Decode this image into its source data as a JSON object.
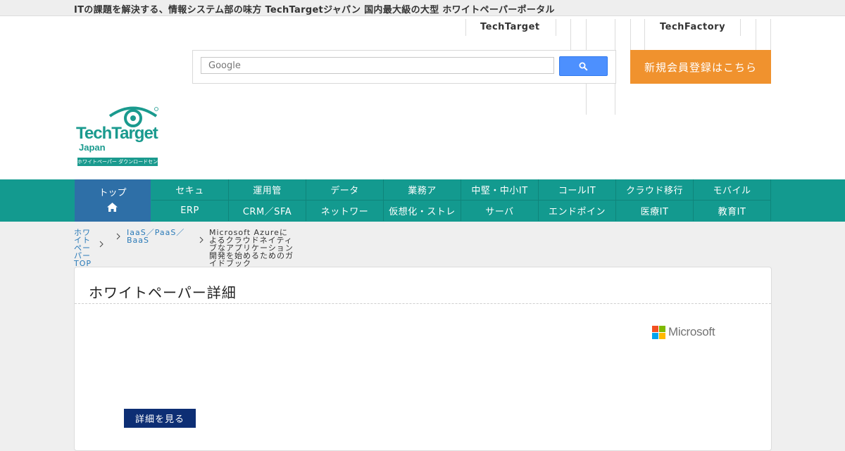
{
  "topbar": {
    "tagline": "ITの課題を解決する、情報システム部の味方 TechTargetジャパン 国内最大級の大型 ホワイトペーパーポータル"
  },
  "header": {
    "links": [
      "TechTarget",
      "TechFactory"
    ],
    "search": {
      "placeholder": "Google"
    },
    "register_label": "新規会員登録はこちら",
    "logo": {
      "line1": "TechTarget",
      "line2": "Japan",
      "line3": "ホワイトペーパー ダウンロードセンター"
    }
  },
  "nav": {
    "home_label": "トップ",
    "row1": [
      "セキュ",
      "運用管",
      "データ",
      "業務ア",
      "中堅・中小IT",
      "コールIT",
      "クラウド移行",
      "モバイル"
    ],
    "row2": [
      "ERP",
      "CRM／SFA",
      "ネットワー",
      "仮想化・ストレ",
      "サーバ",
      "エンドポイン",
      "医療IT",
      "教育IT"
    ]
  },
  "breadcrumb": {
    "items": [
      {
        "label": "ホワイトペーパーTOP",
        "link": true
      },
      {
        "label": "IaaS／PaaS／BaaS",
        "link": true
      },
      {
        "label": "Microsoft Azureによるクラウドネイティブなアプリケーション開発を始めるためのガイドブック",
        "link": false
      }
    ]
  },
  "card": {
    "title": "ホワイトペーパー詳細",
    "vendor": "Microsoft",
    "button_label": "詳細を見る"
  },
  "colors": {
    "teal": "#139a8f",
    "orange": "#f0922e",
    "navy": "#0d2e74",
    "home_blue": "#2e6fa7"
  }
}
